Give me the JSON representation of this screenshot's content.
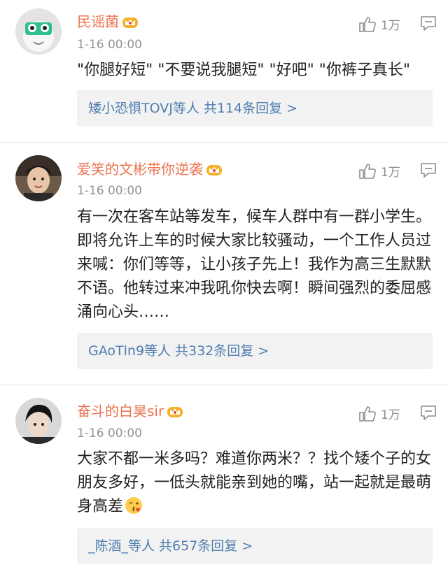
{
  "comments": [
    {
      "username": "民谣菌",
      "time": "1-16 00:00",
      "text": "\"你腿好短\" \"不要说我腿短\" \"好吧\" \"你裤子真长\"",
      "likes": "1万",
      "reply_users": "矮小恐惧TOVJ等人",
      "reply_count": "共114条回复 >"
    },
    {
      "username": "爱笑的文彬带你逆袭",
      "time": "1-16 00:00",
      "text": "有一次在客车站等发车，候车人群中有一群小学生。即将允许上车的时候大家比较骚动，一个工作人员过来喊：你们等等，让小孩子先上！我作为高三生默默不语。他转过来冲我吼你快去啊！瞬间强烈的委屈感涌向心头……",
      "likes": "1万",
      "reply_users": "GAoTln9等人",
      "reply_count": "共332条回复 >"
    },
    {
      "username": "奋斗的白昊sir",
      "time": "1-16 00:00",
      "text": "大家不都一米多吗？难道你两米？？找个矮个子的女朋友多好，一低头就能亲到她的嘴，站一起就是最萌身高差",
      "likes": "1万",
      "reply_users": "_陈酒_等人",
      "reply_count": "共657条回复 >"
    }
  ],
  "colors": {
    "username": "#eb7350",
    "link": "#507daf",
    "time": "#939393",
    "reply_bg": "#f2f2f2"
  },
  "icons": {
    "crown": "vip-crown-icon",
    "like": "thumb-up-icon",
    "reply": "comment-icon",
    "emoji": "kiss-emoji-icon"
  }
}
